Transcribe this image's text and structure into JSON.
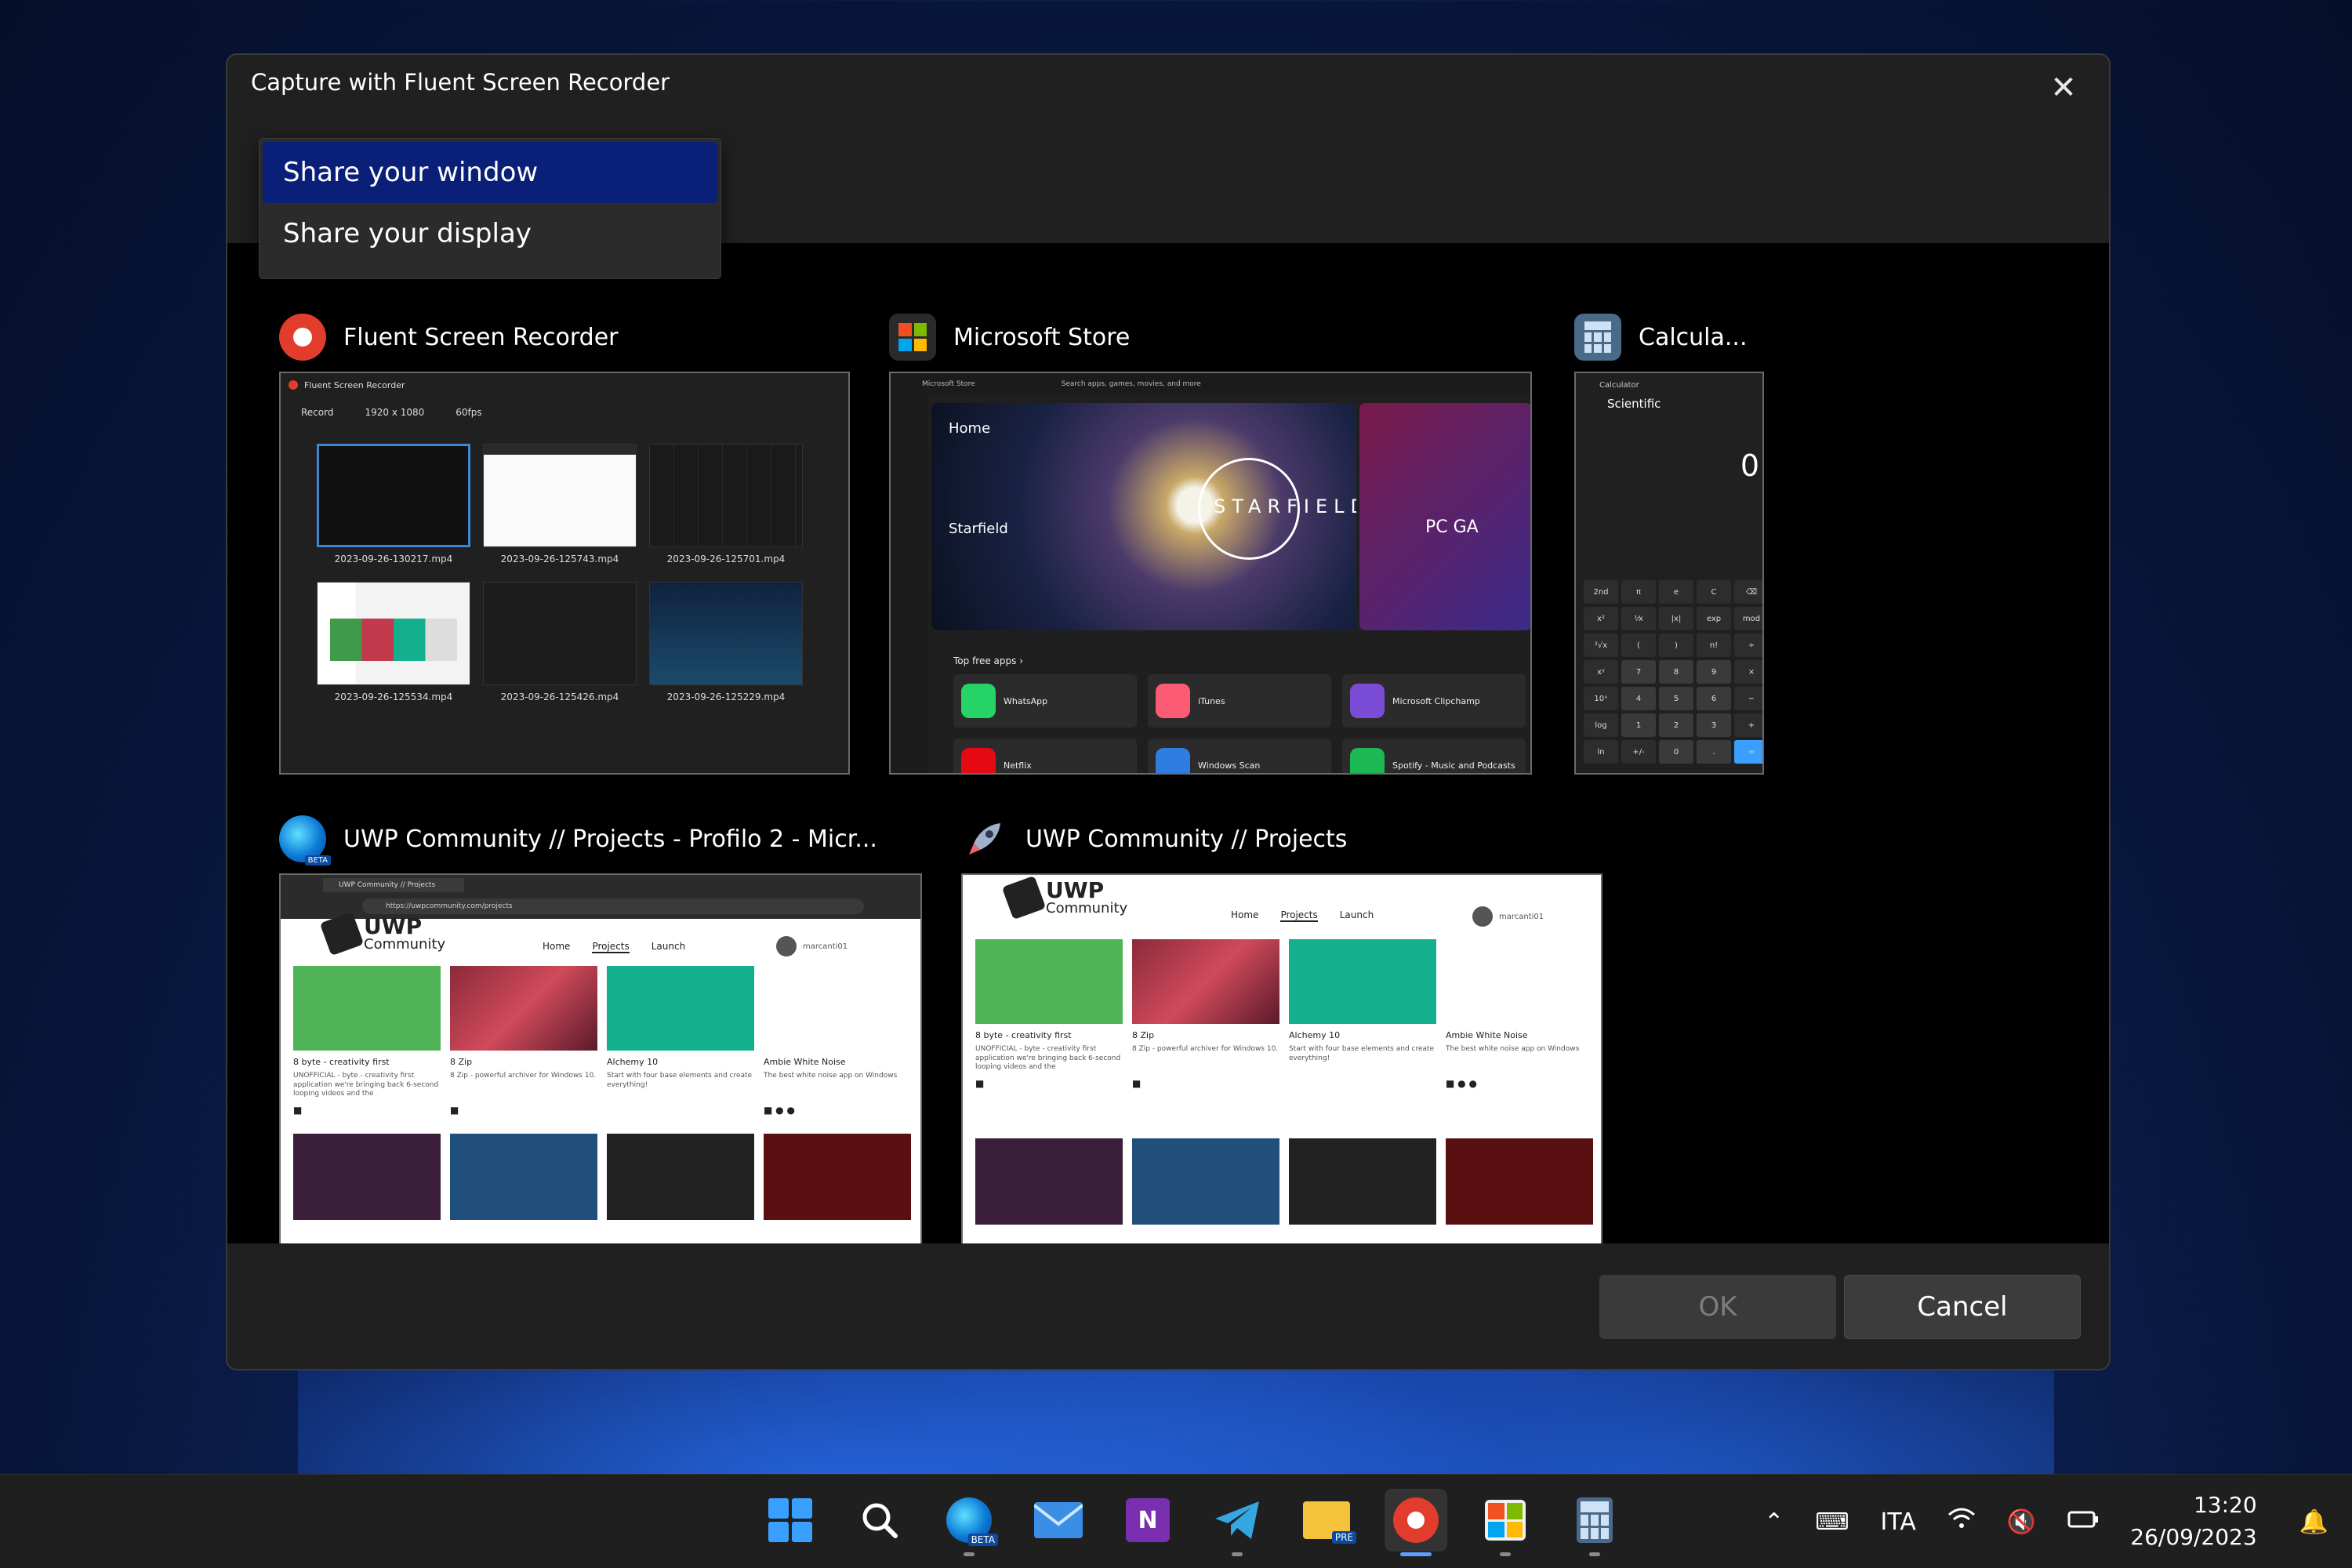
{
  "dialog": {
    "title": "Capture with Fluent Screen Recorder",
    "close_label": "✕",
    "ok_label": "OK",
    "cancel_label": "Cancel"
  },
  "dropdown": {
    "options": [
      "Share your window",
      "Share your display"
    ],
    "selected_index": 0
  },
  "windows": [
    {
      "title": "Fluent Screen Recorder",
      "thumbnail": {
        "app_title": "Fluent Screen Recorder",
        "record_label": "Record",
        "resolution": "1920 x 1080",
        "fps": "60fps",
        "files": [
          "2023-09-26-130217.mp4",
          "2023-09-26-125743.mp4",
          "2023-09-26-125701.mp4",
          "2023-09-26-125534.mp4",
          "2023-09-26-125426.mp4",
          "2023-09-26-125229.mp4"
        ]
      }
    },
    {
      "title": "Microsoft Store",
      "thumbnail": {
        "app_title": "Microsoft Store",
        "search_placeholder": "Search apps, games, movies, and more",
        "home": "Home",
        "hero_title": "Starfield",
        "hero_logo": "STARFIELD",
        "side_promo": "PC GA",
        "section": "Top free apps ›",
        "apps": [
          {
            "name": "WhatsApp",
            "color": "#25d366"
          },
          {
            "name": "iTunes",
            "color": "#fb5c74"
          },
          {
            "name": "Microsoft Clipchamp",
            "color": "#7b4dd6"
          },
          {
            "name": "Netflix",
            "color": "#e50914"
          },
          {
            "name": "Windows Scan",
            "color": "#2f7de1"
          },
          {
            "name": "Spotify - Music and Podcasts",
            "color": "#1db954"
          }
        ]
      }
    },
    {
      "title": "Calcula...",
      "thumbnail": {
        "app_title": "Calculator",
        "mode": "Scientific",
        "display": "0",
        "keys": [
          "2nd",
          "π",
          "e",
          "C",
          "⌫",
          "x²",
          "⅟x",
          "|x|",
          "exp",
          "mod",
          "²√x",
          "(",
          ")",
          "n!",
          "÷",
          "xʸ",
          "7",
          "8",
          "9",
          "×",
          "10ˣ",
          "4",
          "5",
          "6",
          "−",
          "log",
          "1",
          "2",
          "3",
          "+",
          "ln",
          "+/-",
          "0",
          ".",
          "="
        ]
      }
    },
    {
      "title": "UWP Community // Projects - Profilo 2 - Micr...",
      "thumbnail": {
        "tab": "UWP Community // Projects",
        "url": "https://uwpcommunity.com/projects",
        "logo_line1": "UWP",
        "logo_line2": "Community",
        "nav": [
          "Home",
          "Projects",
          "Launch"
        ],
        "user": "marcanti01",
        "cards": [
          {
            "name": "8 byte - creativity first",
            "desc": "UNOFFICIAL - byte - creativity first application we're bringing back 6-second looping videos and the"
          },
          {
            "name": "8 Zip",
            "desc": "8 Zip - powerful archiver for Windows 10."
          },
          {
            "name": "Alchemy 10",
            "desc": "Start with four base elements and create everything!"
          },
          {
            "name": "Ambie White Noise",
            "desc": "The best white noise app on Windows"
          }
        ]
      }
    },
    {
      "title": "UWP Community // Projects"
    }
  ],
  "taskbar": {
    "apps": [
      "start",
      "search",
      "edge-beta",
      "mail",
      "onenote",
      "telegram",
      "file-explorer-preview",
      "fluent-screen-recorder",
      "microsoft-store",
      "calculator"
    ],
    "edge_badge": "BETA",
    "explorer_badge": "PRE",
    "onenote_letter": "N",
    "language": "ITA",
    "time": "13:20",
    "date": "26/09/2023",
    "chevron": "⌃",
    "colors": {
      "accent": "#5aa0ff",
      "record": "#e23c2c",
      "selected_option": "#0a1f78"
    }
  }
}
